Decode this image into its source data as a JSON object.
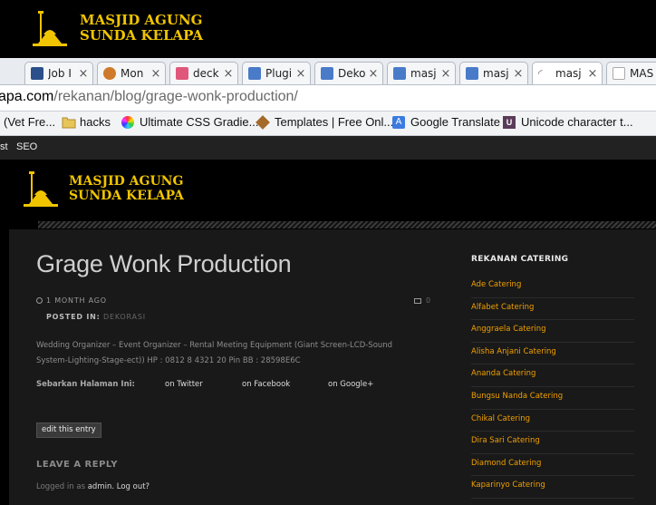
{
  "top_logo": {
    "line1": "MASJID AGUNG",
    "line2": "SUNDA KELAPA"
  },
  "tabs": [
    {
      "label": "Job I",
      "icon": "job-favicon-icon",
      "color": "#2b4f8a"
    },
    {
      "label": "Mon",
      "icon": "firefox-favicon-icon",
      "color": "#cf7a2a"
    },
    {
      "label": "deck",
      "icon": "slideshare-favicon-icon",
      "color": "#e0577b"
    },
    {
      "label": "Plugi",
      "icon": "wordpress-page-icon",
      "color": "#4a7bc8"
    },
    {
      "label": "Deko",
      "icon": "wordpress-page-icon",
      "color": "#4a7bc8"
    },
    {
      "label": "masj",
      "icon": "wordpress-page-icon",
      "color": "#4a7bc8"
    },
    {
      "label": "masj",
      "icon": "wordpress-page-icon",
      "color": "#4a7bc8"
    },
    {
      "label": "masj",
      "icon": "loading-spinner-icon",
      "color": "#777777"
    },
    {
      "label": "MAS",
      "icon": "blank-page-icon",
      "color": "#bbbbbb"
    }
  ],
  "url": {
    "host": "apa.com",
    "path": "/rekanan/blog/grage-wonk-production/"
  },
  "bookmarks": [
    {
      "label": "(Vet Fre...",
      "icon": ""
    },
    {
      "label": "hacks",
      "icon": "folder-icon"
    },
    {
      "label": "Ultimate CSS Gradie...",
      "icon": "gradient-icon"
    },
    {
      "label": "Templates | Free Onl...",
      "icon": "template-icon"
    },
    {
      "label": "Google Translate",
      "icon": "translate-icon"
    },
    {
      "label": "Unicode character t...",
      "icon": "unicode-icon"
    }
  ],
  "adminbar": {
    "item1": "st",
    "item2": "SEO"
  },
  "site_logo": {
    "line1": "MASJID AGUNG",
    "line2": "SUNDA KELAPA"
  },
  "post": {
    "title": "Grage Wonk Production",
    "date": "1 MONTH AGO",
    "posted_in_label": "POSTED IN:",
    "category": "DEKORASI",
    "comment_count": "0",
    "body": "Wedding Organizer – Event Organizer – Rental Meeting Equipment (Giant Screen-LCD-Sound System-Lighting-Stage-ect)) HP : 0812 8 4321 20 Pin BB : 28598E6C",
    "share_label": "Sebarkan Halaman Ini:",
    "share_twitter": "on Twitter",
    "share_facebook": "on Facebook",
    "share_google": "on Google+",
    "edit_label": "edit this entry",
    "reply_heading": "LEAVE A REPLY",
    "logged_in_prefix": "Logged in as",
    "logged_in_user": "admin",
    "logout": "Log out?"
  },
  "sidebar": {
    "title": "REKANAN CATERING",
    "items": [
      "Ade Catering",
      "Alfabet Catering",
      "Anggraela Catering",
      "Alisha Anjani Catering",
      "Ananda Catering",
      "Bungsu Nanda Catering",
      "Chikal Catering",
      "Dira Sari Catering",
      "Diamond Catering",
      "Kaparinyo Catering"
    ]
  },
  "colors": {
    "accent": "#f0a000",
    "logo_gold": "#f0c400",
    "background": "#000000",
    "content_bg": "#191919"
  }
}
